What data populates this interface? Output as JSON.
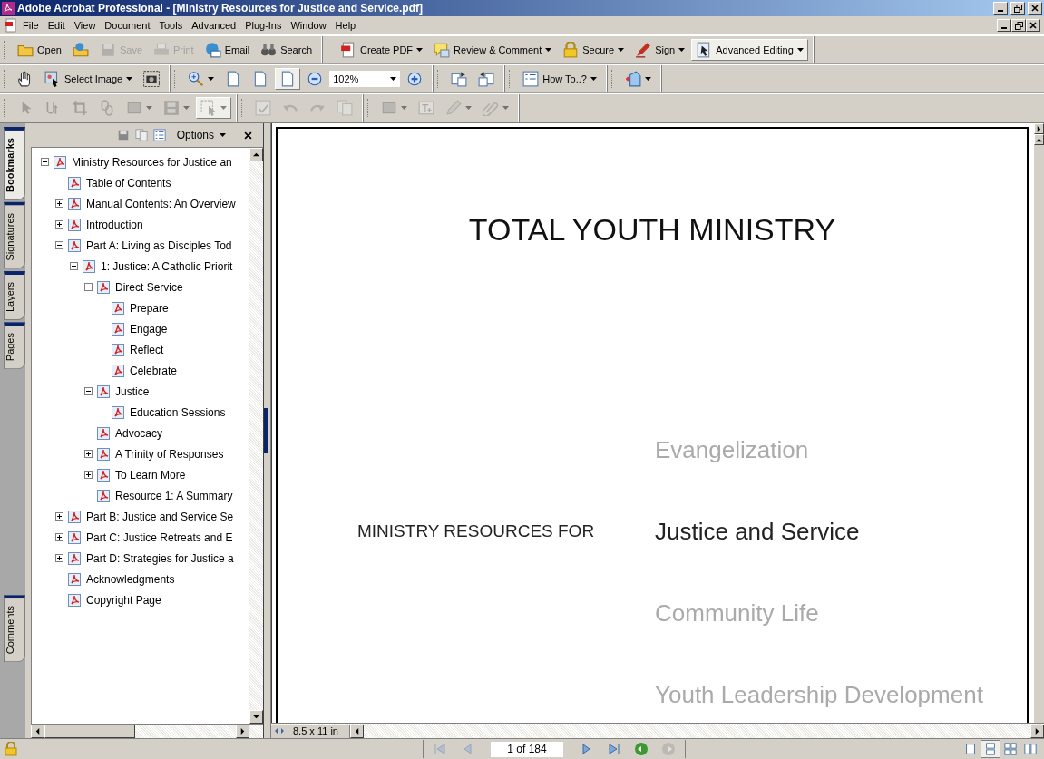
{
  "window": {
    "title": "Adobe Acrobat Professional - [Ministry Resources for Justice and Service.pdf]"
  },
  "menu": [
    "File",
    "Edit",
    "View",
    "Document",
    "Tools",
    "Advanced",
    "Plug-Ins",
    "Window",
    "Help"
  ],
  "toolbars": [
    {
      "groups": [
        [
          {
            "label": "Open",
            "dropdown": false,
            "disabled": false,
            "pressed": false
          },
          {
            "dropdown": false,
            "disabled": false,
            "pressed": false
          },
          {
            "label": "Save",
            "dropdown": false,
            "disabled": true,
            "pressed": false
          },
          {
            "label": "Print",
            "dropdown": false,
            "disabled": true,
            "pressed": false
          },
          {
            "label": "Email",
            "dropdown": false,
            "disabled": false,
            "pressed": false
          },
          {
            "label": "Search",
            "dropdown": false,
            "disabled": false,
            "pressed": false
          }
        ],
        [
          {
            "label": "Create PDF",
            "dropdown": true,
            "disabled": false,
            "pressed": false
          },
          {
            "label": "Review & Comment",
            "dropdown": true,
            "disabled": false,
            "pressed": false
          },
          {
            "label": "Secure",
            "dropdown": true,
            "disabled": false,
            "pressed": false
          },
          {
            "label": "Sign",
            "dropdown": true,
            "disabled": false,
            "pressed": false
          },
          {
            "label": "Advanced Editing",
            "dropdown": true,
            "disabled": false,
            "pressed": true
          }
        ]
      ]
    },
    {
      "groups": [
        [
          {
            "dropdown": false,
            "disabled": false,
            "pressed": false
          },
          {
            "label": "Select Image",
            "dropdown": true,
            "disabled": false,
            "pressed": false
          },
          {
            "dropdown": false,
            "disabled": false,
            "pressed": false
          }
        ],
        [
          {
            "dropdown": true,
            "disabled": false,
            "pressed": false
          },
          {
            "dropdown": false,
            "disabled": false,
            "pressed": false
          },
          {
            "dropdown": false,
            "disabled": false,
            "pressed": false
          },
          {
            "dropdown": false,
            "disabled": false,
            "pressed": true
          },
          {
            "dropdown": false,
            "disabled": false,
            "pressed": false
          },
          {
            "value": "102%",
            "dropdown": true,
            "disabled": false,
            "pressed": false
          },
          {
            "dropdown": false,
            "disabled": false,
            "pressed": false
          }
        ],
        [
          {
            "dropdown": false,
            "disabled": false,
            "pressed": false
          },
          {
            "dropdown": false,
            "disabled": false,
            "pressed": false
          }
        ],
        [
          {
            "label": "How To..?",
            "dropdown": true,
            "disabled": false,
            "pressed": false
          }
        ],
        [
          {
            "dropdown": true,
            "disabled": false,
            "pressed": false
          }
        ]
      ]
    },
    {
      "groups": [
        [
          {
            "dropdown": false,
            "disabled": true,
            "pressed": false
          },
          {
            "dropdown": false,
            "disabled": true,
            "pressed": false
          },
          {
            "dropdown": false,
            "disabled": true,
            "pressed": false
          },
          {
            "dropdown": false,
            "disabled": true,
            "pressed": false
          },
          {
            "dropdown": true,
            "disabled": true,
            "pressed": false
          },
          {
            "dropdown": true,
            "disabled": true,
            "pressed": false
          },
          {
            "dropdown": true,
            "disabled": true,
            "pressed": true
          }
        ],
        [
          {
            "dropdown": false,
            "disabled": true,
            "pressed": false
          },
          {
            "dropdown": false,
            "disabled": true,
            "pressed": false
          },
          {
            "dropdown": false,
            "disabled": true,
            "pressed": false
          },
          {
            "dropdown": false,
            "disabled": true,
            "pressed": false
          }
        ],
        [
          {
            "dropdown": true,
            "disabled": true,
            "pressed": false
          },
          {
            "dropdown": false,
            "disabled": true,
            "pressed": false
          },
          {
            "dropdown": true,
            "disabled": true,
            "pressed": false
          },
          {
            "dropdown": true,
            "disabled": true,
            "pressed": false
          }
        ]
      ]
    }
  ],
  "side_tabs": [
    {
      "label": "Bookmarks",
      "selected": true
    },
    {
      "label": "Signatures",
      "selected": false
    },
    {
      "label": "Layers",
      "selected": false
    },
    {
      "label": "Pages",
      "selected": false
    },
    {
      "label": "Comments",
      "selected": false
    }
  ],
  "bookmarks_panel": {
    "options": "Options",
    "tree": [
      {
        "label": "Ministry Resources for Justice an",
        "expanded": true,
        "children": [
          {
            "label": "Table of Contents"
          },
          {
            "label": "Manual Contents: An Overview",
            "expanded": false
          },
          {
            "label": "Introduction",
            "expanded": false
          },
          {
            "label": "Part A: Living as Disciples Tod",
            "expanded": true,
            "children": [
              {
                "label": "1: Justice: A Catholic Priorit",
                "expanded": true,
                "children": [
                  {
                    "label": "Direct Service",
                    "expanded": true,
                    "children": [
                      {
                        "label": "Prepare"
                      },
                      {
                        "label": "Engage"
                      },
                      {
                        "label": "Reflect"
                      },
                      {
                        "label": "Celebrate"
                      }
                    ]
                  },
                  {
                    "label": "Justice",
                    "expanded": true,
                    "children": [
                      {
                        "label": "Education Sessions"
                      }
                    ]
                  },
                  {
                    "label": "Advocacy"
                  },
                  {
                    "label": "A Trinity of Responses",
                    "expanded": false
                  },
                  {
                    "label": "To Learn More",
                    "expanded": false
                  },
                  {
                    "label": "Resource 1: A Summary"
                  }
                ]
              }
            ]
          },
          {
            "label": "Part B: Justice and Service Se",
            "expanded": false
          },
          {
            "label": "Part C: Justice Retreats and E",
            "expanded": false
          },
          {
            "label": "Part D: Strategies for Justice a",
            "expanded": false
          },
          {
            "label": "Acknowledgments"
          },
          {
            "label": "Copyright Page"
          }
        ]
      }
    ]
  },
  "document": {
    "heading": "TOTAL YOUTH MINISTRY",
    "lead": "MINISTRY RESOURCES FOR",
    "topics": [
      {
        "label": "Evangelization",
        "highlighted": false
      },
      {
        "label": "Justice and Service",
        "highlighted": true
      },
      {
        "label": "Community Life",
        "highlighted": false
      },
      {
        "label": "Youth Leadership Development",
        "highlighted": false
      }
    ],
    "page_size": "8.5 x 11 in"
  },
  "navigation": {
    "page": "1 of 184",
    "first_disabled": true,
    "prev_disabled": true,
    "next_disabled": false,
    "last_disabled": false,
    "back_disabled": false,
    "forward_disabled": true
  },
  "layouts": [
    {
      "selected": false
    },
    {
      "selected": true
    },
    {
      "selected": false
    },
    {
      "selected": false
    }
  ]
}
